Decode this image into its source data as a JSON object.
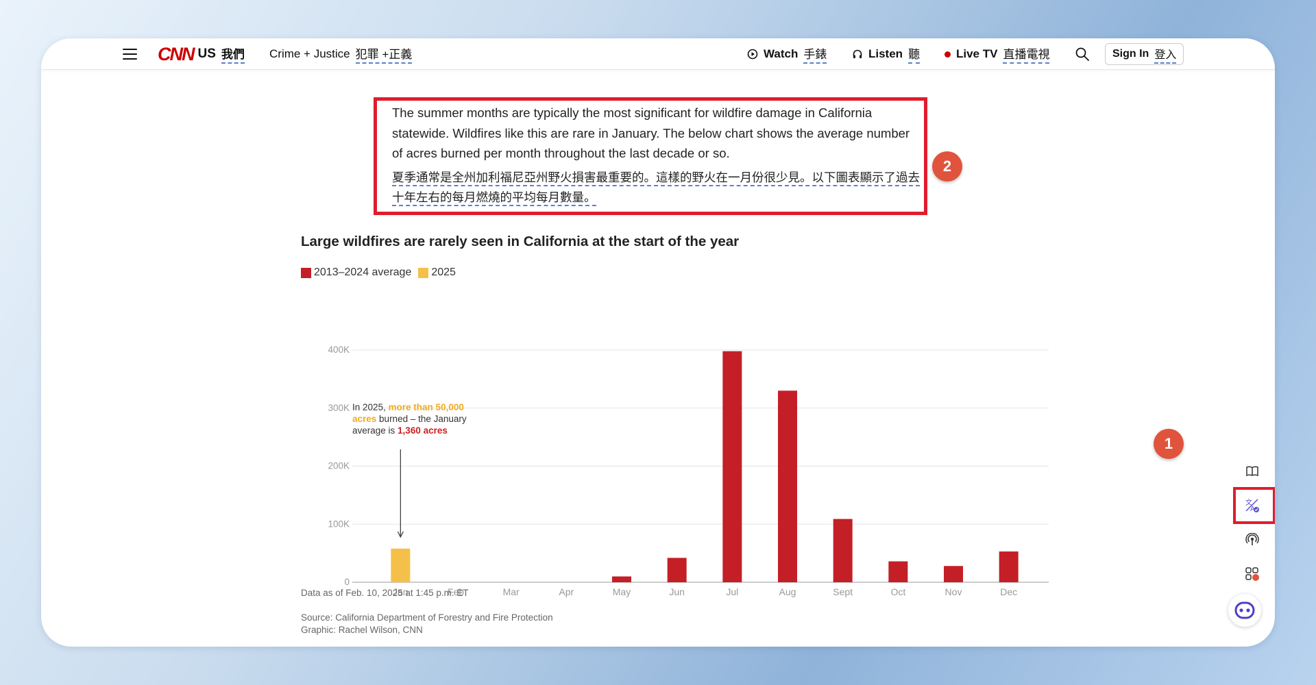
{
  "nav": {
    "edition": "US",
    "edition_trans": "我們",
    "section": "Crime + Justice",
    "section_trans": "犯罪 +正義",
    "watch": "Watch",
    "watch_trans": "手錶",
    "listen": "Listen",
    "listen_trans": "聽",
    "livetv": "Live TV",
    "livetv_trans": "直播電視",
    "signin": "Sign In",
    "signin_trans": "登入"
  },
  "article": {
    "paragraph_en": "The summer months are typically the most significant for wildfire damage in California statewide. Wildfires like this are rare in January. The below chart shows the average number of acres burned per month throughout the last decade or so.",
    "paragraph_zh": "夏季通常是全州加利福尼亞州野火損害最重要的。這樣的野火在一月份很少見。以下圖表顯示了過去十年左右的每月燃燒的平均每月數量。"
  },
  "badges": {
    "one": "1",
    "two": "2"
  },
  "chart_data": {
    "type": "bar",
    "title": "Large wildfires are rarely seen in California at the start of the year",
    "categories": [
      "Jan",
      "Feb",
      "Mar",
      "Apr",
      "May",
      "Jun",
      "Jul",
      "Aug",
      "Sept",
      "Oct",
      "Nov",
      "Dec"
    ],
    "series": [
      {
        "name": "2013–2024 average",
        "color": "#c41f26",
        "values": [
          1360,
          0,
          0,
          0,
          10000,
          42000,
          398000,
          330000,
          109000,
          36000,
          28000,
          53000
        ]
      },
      {
        "name": "2025",
        "color": "#f5c04a",
        "values": [
          58000,
          null,
          null,
          null,
          null,
          null,
          null,
          null,
          null,
          null,
          null,
          null
        ]
      }
    ],
    "yticks": [
      "0",
      "100K",
      "200K",
      "300K",
      "400K"
    ],
    "ytick_values": [
      0,
      100000,
      200000,
      300000,
      400000
    ],
    "ylim": [
      0,
      400000
    ],
    "grid": true,
    "legend": "top-left",
    "annotation": {
      "part1": "In 2025, ",
      "highlight1": "more than 50,000 acres",
      "part2": " burned – the January average is ",
      "highlight2": "1,360 acres"
    },
    "data_note": "Data as of Feb. 10, 2025 at 1:45 p.m. ET",
    "source": "Source: California Department of Forestry and Fire Protection",
    "credit": "Graphic: Rachel Wilson, CNN"
  },
  "colors": {
    "accent_red": "#e01c2d",
    "badge": "#e0533c",
    "translate_underline": "#5b7fd1"
  },
  "icons": [
    "hamburger-icon",
    "cnn-logo",
    "play-icon",
    "headphones-icon",
    "live-dot-icon",
    "search-icon",
    "book-icon",
    "translate-icon",
    "podcast-icon",
    "apps-icon",
    "robot-icon"
  ]
}
